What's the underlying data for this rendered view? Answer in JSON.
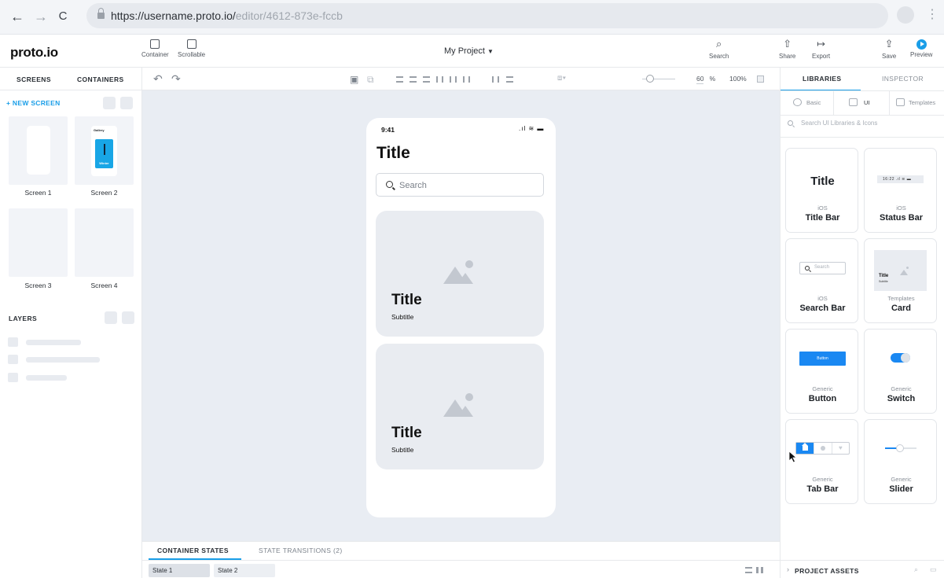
{
  "browser": {
    "back": "←",
    "forward": "→",
    "reload": "C",
    "url_main": "https://username.proto.io/",
    "url_dim": "editor/4612-873e-fccb",
    "menu": "⋮"
  },
  "app": {
    "logo": "proto.io",
    "project_name": "My Project",
    "tools": {
      "container": "Container",
      "scrollable": "Scrollable",
      "search": "Search",
      "share": "Share",
      "export": "Export",
      "save": "Save",
      "preview": "Preview"
    }
  },
  "left_panel": {
    "tabs": [
      "SCREENS",
      "CONTAINERS"
    ],
    "new_screen": "+ NEW SCREEN",
    "screens": [
      "Screen 1",
      "Screen 2",
      "Screen 3",
      "Screen 4"
    ],
    "screen2_thumb": {
      "header": "Gallery",
      "caption": "Winter"
    },
    "layers_label": "LAYERS"
  },
  "canvas_toolbar": {
    "undo": "↶",
    "redo": "↷",
    "zoom_value": "60",
    "zoom_unit": "%",
    "zoom_fit": "100%"
  },
  "device": {
    "time": "9:41",
    "status_icons": ".ıl ≋ ▬",
    "title": "Title",
    "search_placeholder": "Search",
    "cards": [
      {
        "title": "Title",
        "subtitle": "Subtitle"
      },
      {
        "title": "Title",
        "subtitle": "Subtitle"
      }
    ]
  },
  "states_bar": {
    "tabs": [
      "CONTAINER STATES",
      "STATE TRANSITIONS (2)"
    ],
    "states": [
      "State 1",
      "State 2"
    ]
  },
  "right_panel": {
    "tabs": [
      "LIBRARIES",
      "INSPECTOR"
    ],
    "subtabs": [
      "Basic",
      "UI",
      "Templates"
    ],
    "search_placeholder": "Search UI Libraries & Icons",
    "tiles": [
      {
        "category": "iOS",
        "name": "Title Bar",
        "preview": "Title"
      },
      {
        "category": "iOS",
        "name": "Status Bar",
        "preview": "16:22  .ıl ≋ ▬"
      },
      {
        "category": "iOS",
        "name": "Search Bar",
        "preview": "Search"
      },
      {
        "category": "Templates",
        "name": "Card",
        "preview": "Title",
        "preview_sub": "Subtitle"
      },
      {
        "category": "Generic",
        "name": "Button",
        "preview": "Button"
      },
      {
        "category": "Generic",
        "name": "Switch"
      },
      {
        "category": "Generic",
        "name": "Tab Bar"
      },
      {
        "category": "Generic",
        "name": "Slider"
      }
    ],
    "project_assets": "PROJECT ASSETS"
  },
  "colors": {
    "accent": "#1a9ee8",
    "component_blue": "#1a88f2",
    "canvas_bg": "#e9edf3"
  },
  "icons": {
    "lock": "lock-icon",
    "profile": "avatar",
    "cursor": "cursor-arrow-icon"
  }
}
